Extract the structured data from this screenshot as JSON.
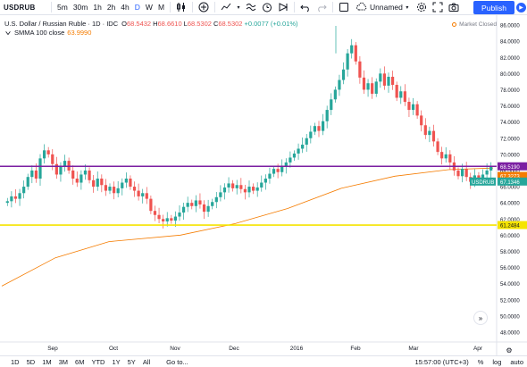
{
  "toolbar": {
    "symbol": "USDRUB",
    "timeframes": [
      "5m",
      "30m",
      "1h",
      "2h",
      "4h",
      "D",
      "W",
      "M"
    ],
    "active_timeframe": "D",
    "layout_name": "Unnamed",
    "publish_label": "Publish"
  },
  "legend": {
    "title": "U.S. Dollar / Russian Ruble · 1D · IDC",
    "ohlc": [
      {
        "k": "O",
        "v": "68.5432"
      },
      {
        "k": "H",
        "v": "68.6610"
      },
      {
        "k": "L",
        "v": "68.5302"
      },
      {
        "k": "C",
        "v": "68.5302"
      }
    ],
    "change": "+0.0077 (+0.01%)",
    "indicator_label": "SMMA 100 close",
    "indicator_value": "63.9990"
  },
  "market_status": "Market Closed",
  "price_axis": {
    "labels": [
      "86.0000",
      "84.0000",
      "82.0000",
      "80.0000",
      "78.0000",
      "76.0000",
      "74.0000",
      "72.0000",
      "70.0000",
      "68.0000",
      "66.0000",
      "64.0000",
      "62.0000",
      "60.0000",
      "58.0000",
      "56.0000",
      "54.0000",
      "52.0000",
      "50.0000",
      "48.0000"
    ],
    "tags": {
      "purple": "68.5190",
      "orange": "67.3273",
      "symbol_name": "USDRUB",
      "symbol_price": "67.1346",
      "yellow": "61.2484"
    }
  },
  "time_axis": {
    "labels": [
      "Sep",
      "Oct",
      "Nov",
      "Dec",
      "2016",
      "Feb",
      "Mar",
      "Apr"
    ]
  },
  "chart_data": {
    "type": "candlestick",
    "title": "U.S. Dollar / Russian Ruble · 1D · IDC",
    "ylim": [
      47,
      87
    ],
    "horizontal_lines": [
      {
        "value": 68.519,
        "color": "#7b1fa2"
      },
      {
        "value": 61.2484,
        "color": "#f5e400"
      }
    ],
    "series": [
      {
        "name": "SMMA 100 close",
        "color": "#f57c00",
        "type": "line",
        "keypoints": [
          [
            0,
            53.7
          ],
          [
            60,
            57.2
          ],
          [
            120,
            59.2
          ],
          [
            200,
            60.0
          ],
          [
            260,
            61.4
          ],
          [
            320,
            63.3
          ],
          [
            380,
            65.8
          ],
          [
            440,
            67.3
          ],
          [
            500,
            68.1
          ],
          [
            550,
            68.3
          ]
        ]
      },
      {
        "name": "USDRUB",
        "type": "candles",
        "closes": [
          64.2,
          64.8,
          64.5,
          65.2,
          66.0,
          67.2,
          68.0,
          67.0,
          69.5,
          70.5,
          70.0,
          68.8,
          67.5,
          68.5,
          69.2,
          68.0,
          67.0,
          66.5,
          67.5,
          68.0,
          66.8,
          66.0,
          67.0,
          66.2,
          65.5,
          66.0,
          65.2,
          65.8,
          66.5,
          67.0,
          66.0,
          65.5,
          64.8,
          65.2,
          64.5,
          63.0,
          62.5,
          62.0,
          61.7,
          62.1,
          61.8,
          62.3,
          62.8,
          63.5,
          64.0,
          63.6,
          64.3,
          63.8,
          62.9,
          63.6,
          64.1,
          64.7,
          65.3,
          65.9,
          66.4,
          65.8,
          66.2,
          65.7,
          65.3,
          66.0,
          65.5,
          65.9,
          66.5,
          67.0,
          67.6,
          68.2,
          67.8,
          68.5,
          69.0,
          69.6,
          70.1,
          70.7,
          71.2,
          72.0,
          72.8,
          73.5,
          72.9,
          74.1,
          75.5,
          76.8,
          78.0,
          79.2,
          80.5,
          82.5,
          83.5,
          81.5,
          79.5,
          78.0,
          78.8,
          77.5,
          79.0,
          80.0,
          78.5,
          79.6,
          78.6,
          77.0,
          77.8,
          76.5,
          75.5,
          76.2,
          74.8,
          73.6,
          72.4,
          72.9,
          71.6,
          70.3,
          69.5,
          70.0,
          69.0,
          68.0,
          67.3,
          68.2,
          67.2,
          66.6,
          67.4,
          66.9,
          67.5,
          68.0,
          68.5
        ]
      }
    ]
  }
}
